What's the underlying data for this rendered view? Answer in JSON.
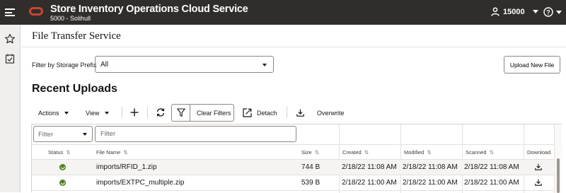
{
  "header": {
    "app_title": "Store Inventory Operations Cloud Service",
    "app_subtitle": "5000 - Solihull",
    "user_id": "15000",
    "icons": [
      "menu-icon",
      "oracle-logo",
      "user-icon",
      "help-icon"
    ]
  },
  "sidebar": {
    "items": [
      "favorites-star-icon",
      "tasks-icon"
    ]
  },
  "page": {
    "title": "File Transfer Service"
  },
  "filters": {
    "prefix_label": "Filter by Storage Prefix",
    "prefix_value": "All",
    "upload_label": "Upload New File"
  },
  "section": {
    "title": "Recent Uploads"
  },
  "toolbar": {
    "actions_label": "Actions",
    "view_label": "View",
    "clear_filters_label": "Clear Filters",
    "detach_label": "Detach",
    "overwrite_label": "Overwrite"
  },
  "table": {
    "filter_select_placeholder": "Filter",
    "filter_input_placeholder": "Filter",
    "columns": [
      "Status",
      "File Name",
      "Size",
      "Created",
      "Modified",
      "Scanned",
      "Download"
    ],
    "rows": [
      {
        "status": "success",
        "file_name": "imports/RFID_1.zip",
        "size": "744 B",
        "created": "2/18/22 11:08 AM",
        "modified": "2/18/22 11:08 AM",
        "scanned": "2/18/22 11:08 AM"
      },
      {
        "status": "success",
        "file_name": "imports/EXTPC_multiple.zip",
        "size": "539 B",
        "created": "2/18/22 11:00 AM",
        "modified": "2/18/22 11:00 AM",
        "scanned": "2/18/22 11:00 AM"
      }
    ]
  },
  "colors": {
    "header_bg": "#312d2a",
    "brand_red": "#c74634",
    "success_green": "#508223",
    "sidebar_bg": "#f1efed"
  }
}
